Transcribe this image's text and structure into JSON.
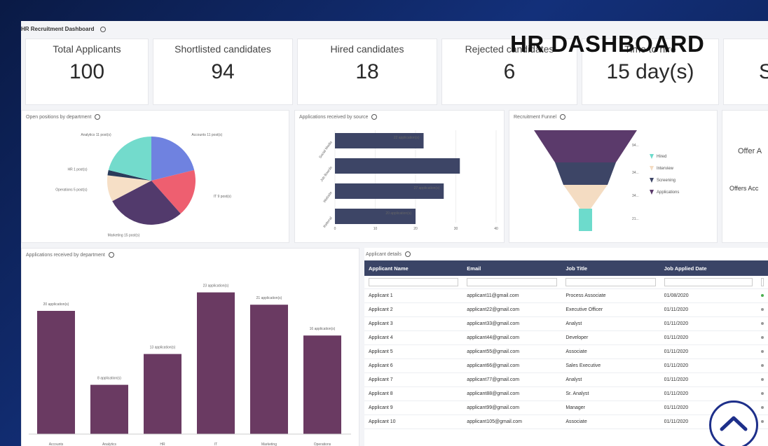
{
  "header": {
    "dashboard_title": "HR Recruitment Dashboard",
    "overlay_title": "HR DASHBOARD"
  },
  "kpis": [
    {
      "label": "Total Applicants",
      "value": "100"
    },
    {
      "label": "Shortlisted candidates",
      "value": "94"
    },
    {
      "label": "Hired candidates",
      "value": "18"
    },
    {
      "label": "Rejected candidates",
      "value": "6"
    },
    {
      "label": "Time to hire",
      "value": "15 day(s)"
    },
    {
      "label": "",
      "value": "S"
    }
  ],
  "sections": {
    "positions": "Open positions by department",
    "sources": "Applications received by source",
    "funnel": "Recruitment Funnel",
    "by_department": "Applications received by department",
    "details": "Applicant details"
  },
  "offer_card": {
    "line1": "Offer A",
    "line2": "Offers Acc"
  },
  "pie": {
    "labels": [
      "Accounts 11 post(s)",
      "IT 9 post(s)",
      "Marketing 15 post(s)",
      "Operations 5 post(s)",
      "HR 1 post(s)",
      "Analytics 11 post(s)"
    ],
    "values": [
      11,
      9,
      15,
      5,
      1,
      11
    ],
    "colors": [
      "#6f82e0",
      "#ee5f70",
      "#523a6c",
      "#f6dfc6",
      "#2a3b5a",
      "#73dbcc"
    ]
  },
  "source_chart": {
    "categories": [
      "Social Media",
      "Job Boards",
      "Website",
      "Referral"
    ],
    "values": [
      22,
      31,
      27,
      20
    ],
    "labels": [
      "22 application(s)",
      "",
      "27 application(s)",
      "20 application(s)"
    ],
    "xticks": [
      "0",
      "10",
      "20",
      "30",
      "40"
    ],
    "xlim": [
      0,
      40
    ],
    "color": "#3d4566"
  },
  "funnel": {
    "stages": [
      "Hired",
      "Interview",
      "Screening",
      "Applications"
    ],
    "values_shown": [
      "94",
      "34",
      "34",
      "21"
    ],
    "colors": [
      "#6ddbcc",
      "#f4dcc2",
      "#3d4566",
      "#5b3a6b"
    ]
  },
  "dept_chart": {
    "categories": [
      "Accounts",
      "Analytics",
      "HR",
      "IT",
      "Marketing",
      "Operations"
    ],
    "values": [
      20,
      8,
      13,
      23,
      21,
      16
    ],
    "labels": [
      "20 application(s)",
      "8 application(s)",
      "13 application(s)",
      "23 application(s)",
      "21 application(s)",
      "16 application(s)"
    ],
    "color": "#6a3a62"
  },
  "table": {
    "headers": [
      "Applicant Name",
      "Email",
      "Job Title",
      "Job Applied Date"
    ],
    "rows": [
      [
        "Applicant 1",
        "applicant11@gmail.com",
        "Process Associate",
        "01/08/2020"
      ],
      [
        "Applicant 2",
        "applicant22@gmail.com",
        "Executive Officer",
        "01/11/2020"
      ],
      [
        "Applicant 3",
        "applicant33@gmail.com",
        "Analyst",
        "01/11/2020"
      ],
      [
        "Applicant 4",
        "applicant44@gmail.com",
        "Developer",
        "01/11/2020"
      ],
      [
        "Applicant 5",
        "applicant55@gmail.com",
        "Associate",
        "01/11/2020"
      ],
      [
        "Applicant 6",
        "applicant66@gmail.com",
        "Sales Executive",
        "01/11/2020"
      ],
      [
        "Applicant 7",
        "applicant77@gmail.com",
        "Analyst",
        "01/11/2020"
      ],
      [
        "Applicant 8",
        "applicant88@gmail.com",
        "Sr. Analyst",
        "01/11/2020"
      ],
      [
        "Applicant 9",
        "applicant99@gmail.com",
        "Manager",
        "01/11/2020"
      ],
      [
        "Applicant 10",
        "applicant105@gmail.com",
        "Associate",
        "01/11/2020"
      ]
    ]
  },
  "icons": {
    "scroll_top": "chevron-up-icon",
    "info": "info-icon"
  },
  "colors": {
    "accent": "#3a4466",
    "scroll_ring": "#1d2f8a"
  }
}
